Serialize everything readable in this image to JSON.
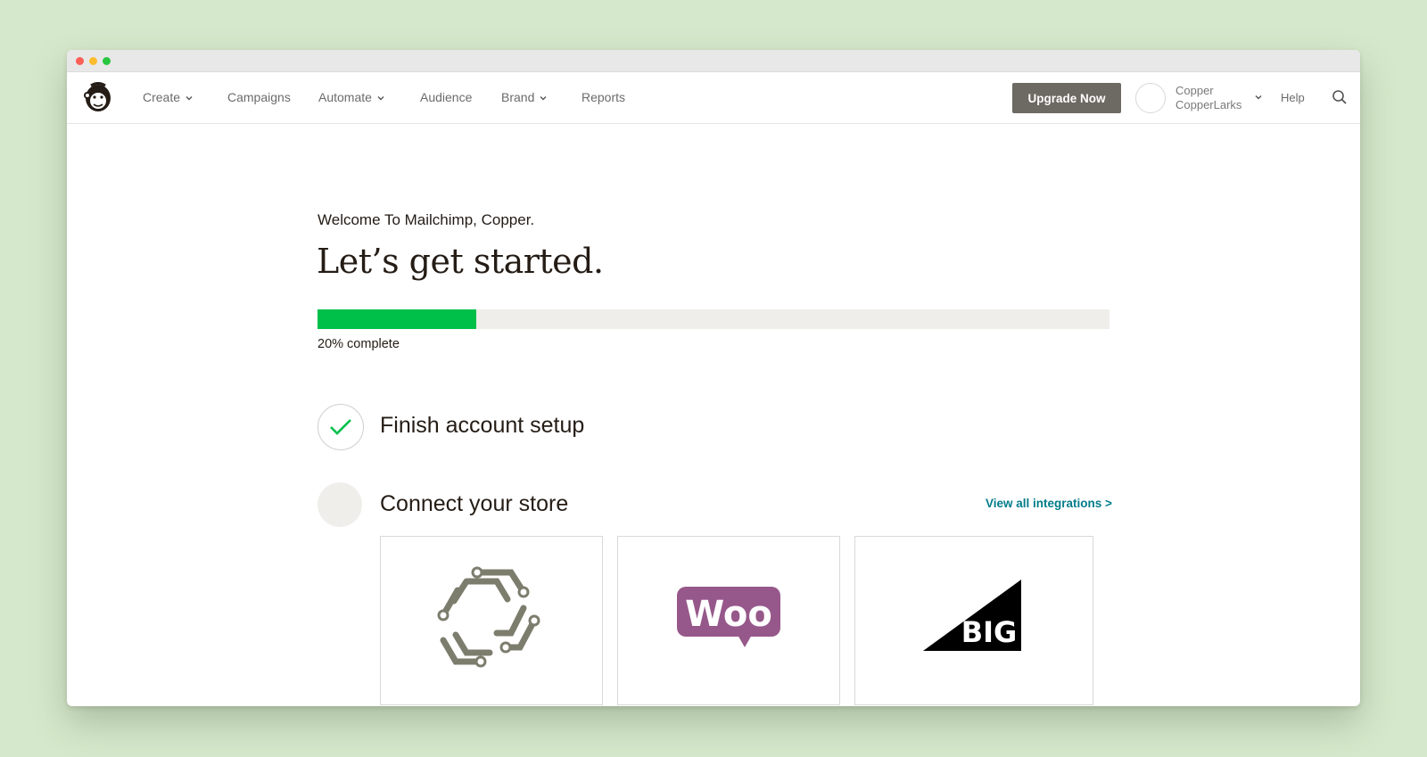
{
  "nav": {
    "items": [
      {
        "label": "Create",
        "has_menu": true
      },
      {
        "label": "Campaigns",
        "has_menu": false
      },
      {
        "label": "Automate",
        "has_menu": true
      },
      {
        "label": "Audience",
        "has_menu": false
      },
      {
        "label": "Brand",
        "has_menu": true
      },
      {
        "label": "Reports",
        "has_menu": false
      }
    ],
    "upgrade_label": "Upgrade Now",
    "user_first": "Copper",
    "user_account": "CopperLarks",
    "help_label": "Help"
  },
  "main": {
    "welcome": "Welcome To Mailchimp, Copper.",
    "headline": "Let’s get started.",
    "progress_percent": 20,
    "progress_label": "20% complete",
    "steps": [
      {
        "title": "Finish account setup",
        "completed": true
      },
      {
        "title": "Connect your store",
        "completed": false
      }
    ],
    "view_all_label": "View all integrations >"
  },
  "integrations": [
    {
      "name": "hexagon-logo-icon"
    },
    {
      "name": "woo-logo-icon",
      "text": "Woo"
    },
    {
      "name": "bigcommerce-logo-icon",
      "text": "BIG"
    }
  ],
  "colors": {
    "accent": "#00c04a",
    "upgrade_bg": "#6d6963",
    "link": "#007c89",
    "woo_purple": "#96588a",
    "page_bg": "#d6e8cb"
  }
}
